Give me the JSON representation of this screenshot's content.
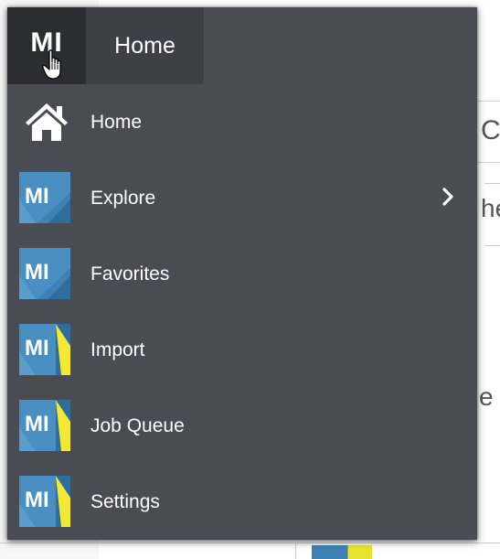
{
  "header": {
    "logo_text": "MI",
    "active_tab": "Home"
  },
  "background": {
    "partial_letters": [
      "C",
      "he",
      "e"
    ]
  },
  "menu": {
    "items": [
      {
        "label": "Home",
        "icon": "home-icon",
        "has_submenu": false
      },
      {
        "label": "Explore",
        "icon": "mi-tile-icon",
        "has_submenu": true
      },
      {
        "label": "Favorites",
        "icon": "mi-tile-icon",
        "has_submenu": false
      },
      {
        "label": "Import",
        "icon": "mi-tile-yellow-icon",
        "has_submenu": false
      },
      {
        "label": "Job Queue",
        "icon": "mi-tile-yellow-icon",
        "has_submenu": false
      },
      {
        "label": "Settings",
        "icon": "mi-tile-yellow-icon",
        "has_submenu": false
      }
    ],
    "tile_text": "MI"
  },
  "colors": {
    "menu_bg": "#494c52",
    "logo_bg": "#2b2d31",
    "tab_bg": "#3d4046",
    "tile_blue": "#3e82b5",
    "tile_yellow": "#f3e832"
  }
}
